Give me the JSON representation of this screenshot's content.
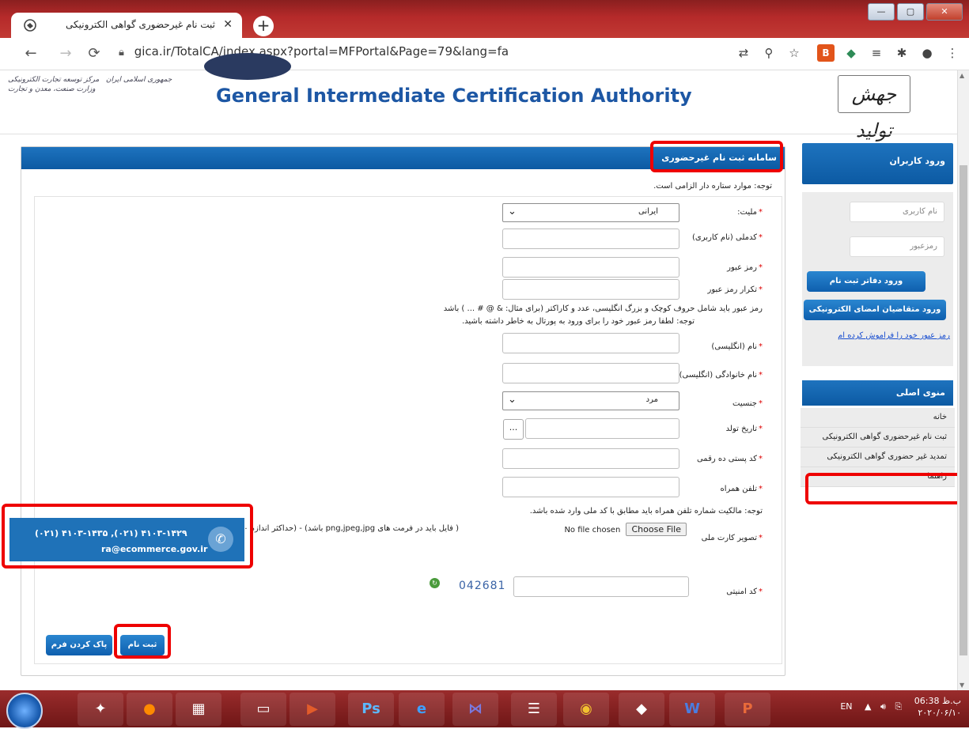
{
  "browser": {
    "tab_title": "ثبت نام غیرحضوری گواهی الکترونیکی",
    "tab_close": "✕",
    "new_tab": "+",
    "url": "gica.ir/TotalCA/index.aspx?portal=MFPortal&Page=79&lang=fa",
    "window_controls": {
      "minimize": "—",
      "maximize": "▢",
      "close": "✕"
    }
  },
  "header": {
    "authority": "General Intermediate Certification Authority",
    "left_logo_text": "جمهوری اسلامی ایران   مرکز توسعه تجارت الکترونیکی\nوزارت صنعت، معدن و تجارت",
    "brand": "جهش تولید"
  },
  "form": {
    "title": "سامانه ثبت نام غیرحضوری",
    "required_note": "توجه: موارد ستاره دار الزامی است.",
    "star": "*",
    "nationality_label": "ملیت:",
    "nationality_value": "ایرانی",
    "national_id_label": "کدملی (نام کاربری)",
    "password_label": "رمز عبور",
    "password_repeat_label": "تکرار رمز عبور",
    "password_hint1": "رمز عبور باید شامل حروف کوچک و بزرگ انگلیسی، عدد و کاراکتر (برای مثال: & @ # ... ) باشد",
    "password_hint2": "توجه: لطفا رمز عبور خود را برای ورود به پورتال به خاطر داشته باشید.",
    "first_name_label": "نام (انگلیسی)",
    "last_name_label": "نام خانوادگی (انگلیسی)",
    "gender_label": "جنسیت",
    "gender_value": "مرد",
    "birth_date_label": "تاریخ تولد",
    "dots": "...",
    "postal_label": "کد پستی ده رقمی",
    "mobile_label": "تلفن همراه",
    "mobile_hint": "توجه: مالکیت شماره تلفن همراه باید مطابق با کد ملی وارد شده باشد.",
    "id_card_label": "تصویر کارت ملی",
    "file_button": "Choose File",
    "file_status": "No file chosen",
    "file_hint": "( فایل باید در فرمت های png,jpeg,jpg باشد) - (حداکثر اندازه ۱۰۰ کیلو بایت میباشد)",
    "captcha_label": "کد امنیتی",
    "captcha_value": "042681",
    "submit": "ثبت نام",
    "clear": "پاک کردن فرم"
  },
  "contact": {
    "phones": "(۰۲۱) ۴۱۰۳-۱۴۳۵ ,(۰۲۱) ۴۱۰۳-۱۴۲۹",
    "email": "ra@ecommerce.gov.ir"
  },
  "sidebar": {
    "login_title": "ورود کاربران",
    "username_placeholder": "نام کاربری",
    "password_placeholder": "رمزعبور",
    "btn_registry": "ورود دفاتر ثبت نام",
    "btn_applicants": "ورود متقاضیان امضای الکترونیکی",
    "forgot_link": "رمز عبور خود را فراموش کرده ام",
    "menu_title": "منوی اصلی",
    "menu_items": [
      "خانه",
      "ثبت نام غیرحضوری گواهی الکترونیکی",
      "تمدید غیر حضوری گواهی الکترونیکی",
      "راهنما"
    ]
  },
  "taskbar": {
    "lang": "EN",
    "time": "06:38 ب.ظ",
    "date": "۲۰۲۰/۰۶/۱۰"
  }
}
